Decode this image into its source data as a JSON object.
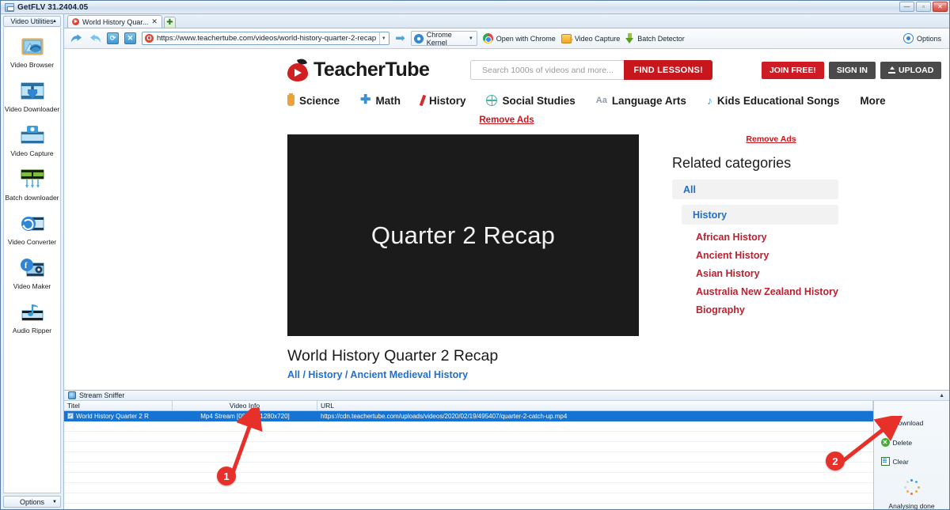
{
  "window": {
    "title": "GetFLV 31.2404.05",
    "controls": {
      "minimize": "—",
      "maximize": "▫",
      "close": "✕"
    }
  },
  "sidebar": {
    "header": "Video Utilities",
    "items": [
      {
        "label": "Video Browser",
        "icon": "video-browser-icon"
      },
      {
        "label": "Video Downloader",
        "icon": "video-downloader-icon"
      },
      {
        "label": "Video Capture",
        "icon": "video-capture-icon"
      },
      {
        "label": "Batch downloader",
        "icon": "batch-downloader-icon"
      },
      {
        "label": "Video Converter",
        "icon": "video-converter-icon"
      },
      {
        "label": "Video Maker",
        "icon": "video-maker-icon"
      },
      {
        "label": "Audio Ripper",
        "icon": "audio-ripper-icon"
      }
    ],
    "options": "Options"
  },
  "browser": {
    "tab": {
      "label": "World History Quar...",
      "close": "✕"
    },
    "new_tab": "✚",
    "toolbar": {
      "back": "◀",
      "forward": "▶",
      "refresh": "⟳",
      "stop": "✕",
      "url": "https://www.teachertube.com/videos/world-history-quarter-2-recap",
      "go": "➡",
      "kernel": "Chrome Kernel",
      "open_with_chrome": "Open with Chrome",
      "video_capture": "Video Capture",
      "batch_detector": "Batch Detector",
      "options": "Options"
    }
  },
  "site": {
    "brand": "TeacherTube",
    "search": {
      "placeholder": "Search 1000s of videos and more...",
      "button": "FIND LESSONS!"
    },
    "account": {
      "join": "JOIN FREE!",
      "signin": "SIGN IN",
      "upload": "UPLOAD"
    },
    "nav": [
      {
        "label": "Science",
        "icon": "test-tube-icon"
      },
      {
        "label": "Math",
        "icon": "plus-icon"
      },
      {
        "label": "History",
        "icon": "quill-pen-icon"
      },
      {
        "label": "Social Studies",
        "icon": "globe-icon"
      },
      {
        "label": "Language Arts",
        "icon": "aa-text-icon"
      },
      {
        "label": "Kids Educational Songs",
        "icon": "music-note-icon"
      },
      {
        "label": "More",
        "icon": ""
      }
    ],
    "remove_ads_top": "Remove Ads",
    "remove_ads_side": "Remove Ads",
    "player": {
      "overlay_text": "Quarter 2 Recap"
    },
    "video": {
      "title": "World History Quarter 2 Recap",
      "breadcrumb": [
        "All",
        "History",
        "Ancient Medieval History"
      ],
      "breadcrumb_text": "All / History / Ancient Medieval History"
    },
    "related": {
      "heading": "Related categories",
      "all": "All",
      "history": "History",
      "links": [
        "African History",
        "Ancient History",
        "Asian History",
        "Australia New Zealand History",
        "Biography"
      ]
    }
  },
  "sniffer": {
    "panel_title": "Stream Sniffer",
    "collapse": "▲",
    "columns": [
      "Titel",
      "Video Info",
      "URL"
    ],
    "rows": [
      {
        "title": "World History Quarter 2 R",
        "info": "Mp4 Stream [08:15 - 1280x720]",
        "url": "https://cdn.teachertube.com/uploads/videos/2020/02/19/495407/quarter-2-catch-up.mp4",
        "selected": true
      }
    ],
    "actions": [
      {
        "label": "Download",
        "icon": "download-icon"
      },
      {
        "label": "Delete",
        "icon": "delete-icon"
      },
      {
        "label": "Clear",
        "icon": "clear-icon"
      }
    ],
    "status": "Analysing done"
  },
  "annotations": [
    {
      "number": "1",
      "target": "stream-row"
    },
    {
      "number": "2",
      "target": "download-button"
    }
  ],
  "colors": {
    "brand_red": "#c8161d",
    "link_blue": "#1f6fd0",
    "category_red": "#bd2130",
    "selection_blue": "#1673d2",
    "annotation_red": "#e8302b"
  }
}
